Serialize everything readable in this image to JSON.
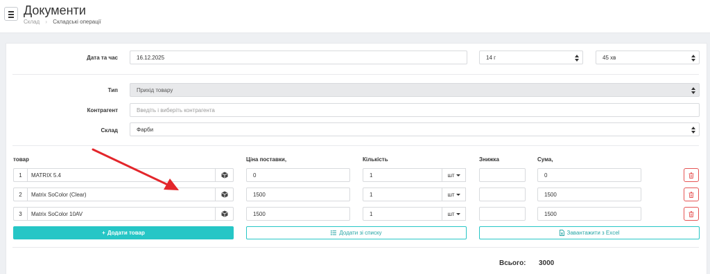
{
  "header": {
    "title": "Документи",
    "breadcrumb": [
      "Склад",
      "Складські операції"
    ]
  },
  "form": {
    "datetime": {
      "label": "Дата та час",
      "date": "16.12.2025",
      "hour": "14 г",
      "minute": "45 хв"
    },
    "type": {
      "label": "Тип",
      "value": "Прихід товару"
    },
    "counterparty": {
      "label": "Контрагент",
      "placeholder": "Введіть і виберіть контрагента"
    },
    "warehouse": {
      "label": "Склад",
      "value": "Фарби"
    }
  },
  "table": {
    "headers": {
      "product": "товар",
      "price": "Ціна поставки,",
      "qty": "Кількість",
      "discount": "Знижка",
      "sum": "Сума,"
    },
    "rows": [
      {
        "n": "1",
        "product": "MATRIX 5.4",
        "price": "0",
        "qty": "1",
        "unit": "шт",
        "discount": "",
        "sum": "0"
      },
      {
        "n": "2",
        "product": "Matrix SoColor (Clear)",
        "price": "1500",
        "qty": "1",
        "unit": "шт",
        "discount": "",
        "sum": "1500"
      },
      {
        "n": "3",
        "product": "Matrix SoColor 10AV",
        "price": "1500",
        "qty": "1",
        "unit": "шт",
        "discount": "",
        "sum": "1500"
      }
    ]
  },
  "actions": {
    "add_product": "Додати товар",
    "add_from_list": "Додати зі списку",
    "import_excel": "Завантажити з Excel"
  },
  "total": {
    "label": "Всього:",
    "value": "3000"
  },
  "colors": {
    "accent": "#26c6c6",
    "danger": "#e55353",
    "annotation_arrow": "#e3262b"
  }
}
